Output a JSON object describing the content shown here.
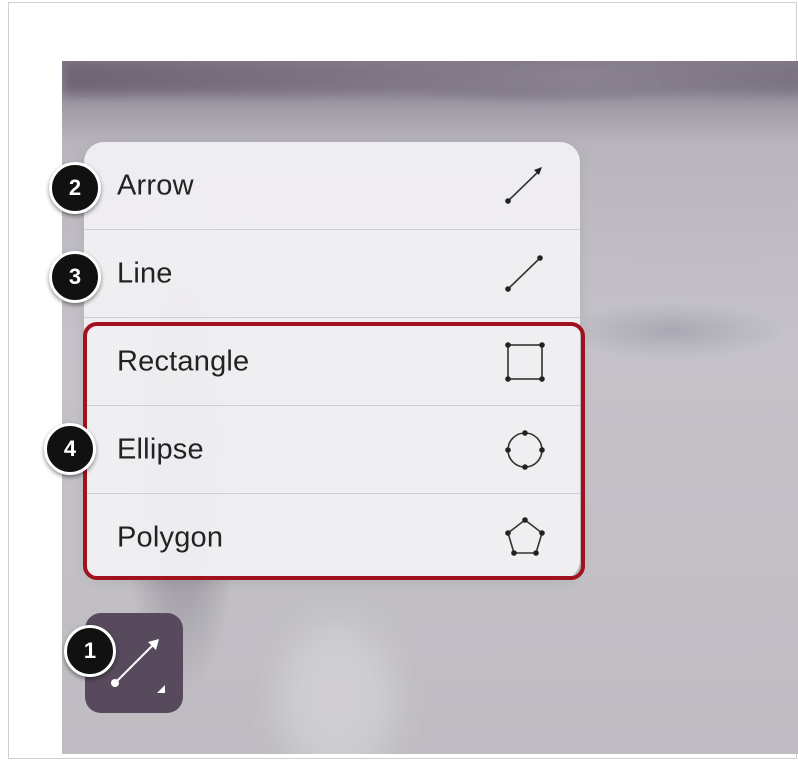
{
  "menu": {
    "items": [
      {
        "label": "Arrow",
        "icon": "arrow-icon"
      },
      {
        "label": "Line",
        "icon": "line-icon"
      },
      {
        "label": "Rectangle",
        "icon": "rectangle-icon"
      },
      {
        "label": "Ellipse",
        "icon": "ellipse-icon"
      },
      {
        "label": "Polygon",
        "icon": "polygon-icon"
      }
    ]
  },
  "tool_button": {
    "icon": "arrow-tool-icon"
  },
  "callouts": [
    "1",
    "2",
    "3",
    "4"
  ],
  "colors": {
    "highlight_border": "#a0121e",
    "tool_button_bg": "#574a5c",
    "callout_bg": "#111111"
  }
}
